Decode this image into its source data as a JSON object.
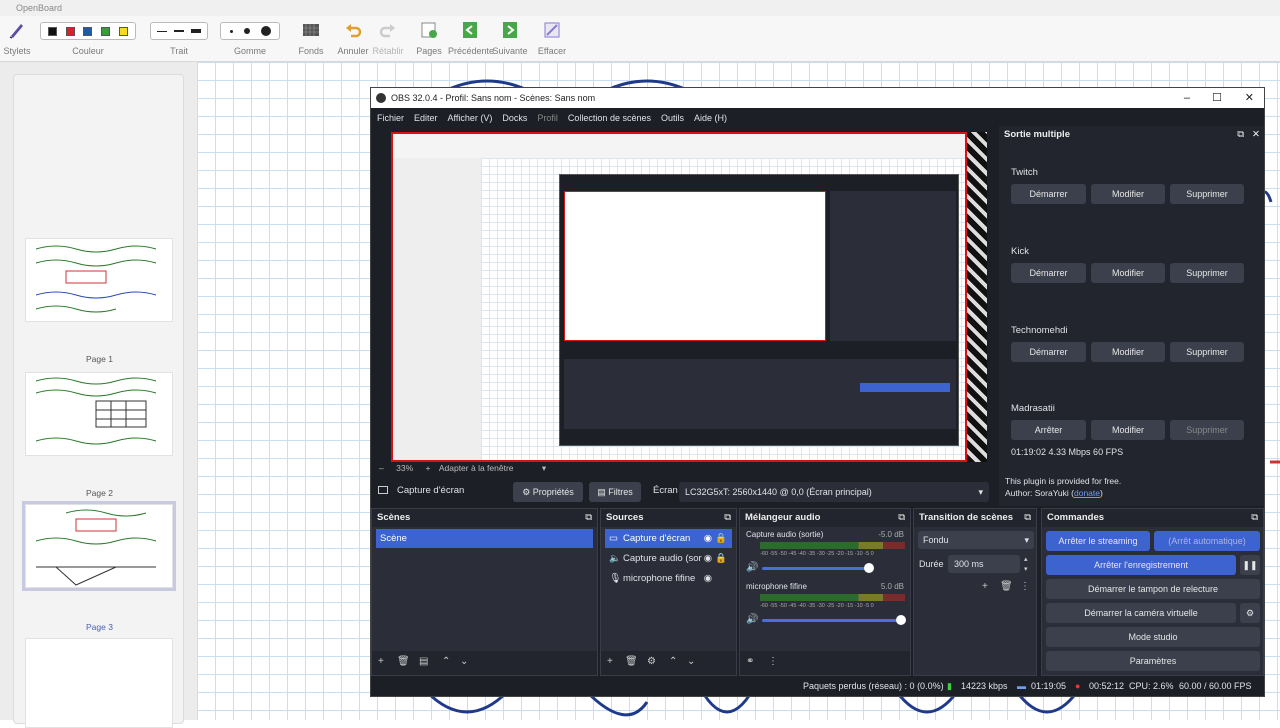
{
  "openboard": {
    "title": "OpenBoard",
    "toolbar": {
      "stylets": "Stylets",
      "couleur": "Couleur",
      "trait": "Trait",
      "gomme": "Gomme",
      "fonds": "Fonds",
      "annuler": "Annuler",
      "retablir": "Rétablir",
      "pages": "Pages",
      "precedente": "Précédente",
      "suivante": "Suivante",
      "effacer": "Effacer"
    },
    "colors": [
      "#111111",
      "#d4232a",
      "#1f5aa6",
      "#3a9b3a",
      "#f5d92b"
    ],
    "pages": [
      "Page 1",
      "Page 2",
      "Page 3"
    ]
  },
  "obs": {
    "title": "OBS 32.0.4 - Profil: Sans nom - Scènes: Sans nom",
    "menu": [
      "Fichier",
      "Editer",
      "Afficher (V)",
      "Docks",
      "Profil",
      "Collection de scènes",
      "Outils",
      "Aide (H)"
    ],
    "zoom": "33%",
    "fit": "Adapter à la fenêtre",
    "source_bar": {
      "name": "Capture d'écran",
      "props": "Propriétés",
      "filters": "Filtres",
      "screen_label": "Écran",
      "screen_value": "LC32G5xT: 2560x1440 @ 0,0 (Écran principal)"
    },
    "multi": {
      "title": "Sortie multiple",
      "targets": [
        {
          "name": "Twitch",
          "start": "Démarrer",
          "edit": "Modifier",
          "del": "Supprimer"
        },
        {
          "name": "Kick",
          "start": "Démarrer",
          "edit": "Modifier",
          "del": "Supprimer"
        },
        {
          "name": "Technomehdi",
          "start": "Démarrer",
          "edit": "Modifier",
          "del": "Supprimer"
        },
        {
          "name": "Madrasatii",
          "start": "Arrêter",
          "edit": "Modifier",
          "del": "Supprimer"
        }
      ],
      "status": "01:19:02  4.33 Mbps  60 FPS",
      "free": "This plugin is provided for free.",
      "author": "Author: SoraYuki (",
      "donate": "donate",
      "author_end": ")"
    },
    "scenes": {
      "title": "Scènes",
      "items": [
        "Scène"
      ]
    },
    "sources": {
      "title": "Sources",
      "items": [
        "Capture d'écran",
        "Capture audio (sor",
        "microphone fifine"
      ]
    },
    "mixer": {
      "title": "Mélangeur audio",
      "channels": [
        {
          "name": "Capture audio (sortie)",
          "db": "-5.0 dB"
        },
        {
          "name": "microphone fifine",
          "db": "5.0 dB"
        }
      ],
      "scale": "-60 -55 -50 -45 -40 -35 -30 -25 -20 -15 -10 -5 0"
    },
    "transition": {
      "title": "Transition de scènes",
      "type": "Fondu",
      "duration_label": "Durée",
      "duration": "300 ms"
    },
    "controls": {
      "title": "Commandes",
      "stop_stream": "Arrêter le streaming",
      "auto_stop": "(Arrêt automatique)",
      "stop_rec": "Arrêter l'enregistrement",
      "replay": "Démarrer le tampon de relecture",
      "vcam": "Démarrer la caméra virtuelle",
      "studio": "Mode studio",
      "settings": "Paramètres"
    },
    "status": {
      "dropped": "Paquets perdus (réseau) : 0 (0.0%)",
      "bitrate": "14223 kbps",
      "stream_time": "01:19:05",
      "rec_time": "00:52:12",
      "cpu": "CPU: 2.6%",
      "fps": "60.00 / 60.00 FPS"
    },
    "colors": {
      "accent": "#3d63d1",
      "bg": "#1d1f26",
      "panel": "#2b2e38"
    }
  }
}
